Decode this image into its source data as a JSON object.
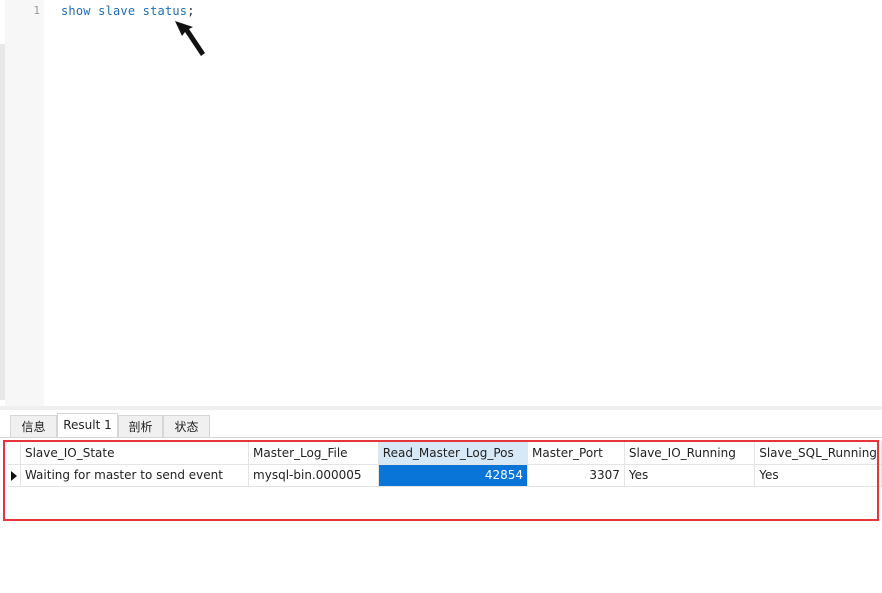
{
  "editor": {
    "line_number": "1",
    "query_text": "show slave status",
    "terminator": ";"
  },
  "tabs": [
    {
      "label": "信息"
    },
    {
      "label": "Result 1"
    },
    {
      "label": "剖析"
    },
    {
      "label": "状态"
    }
  ],
  "result": {
    "columns": [
      "Slave_IO_State",
      "Master_Log_File",
      "Read_Master_Log_Pos",
      "Master_Port",
      "Slave_IO_Running",
      "Slave_SQL_Running"
    ],
    "rows": [
      [
        "Waiting for master to send event",
        "mysql-bin.000005",
        "42854",
        "3307",
        "Yes",
        "Yes"
      ]
    ]
  },
  "colors": {
    "keyword": "#1e6fb5",
    "selected_cell": "#0a75d9",
    "sorted_header": "#d7e8f7",
    "annotation": "#e5343a"
  }
}
